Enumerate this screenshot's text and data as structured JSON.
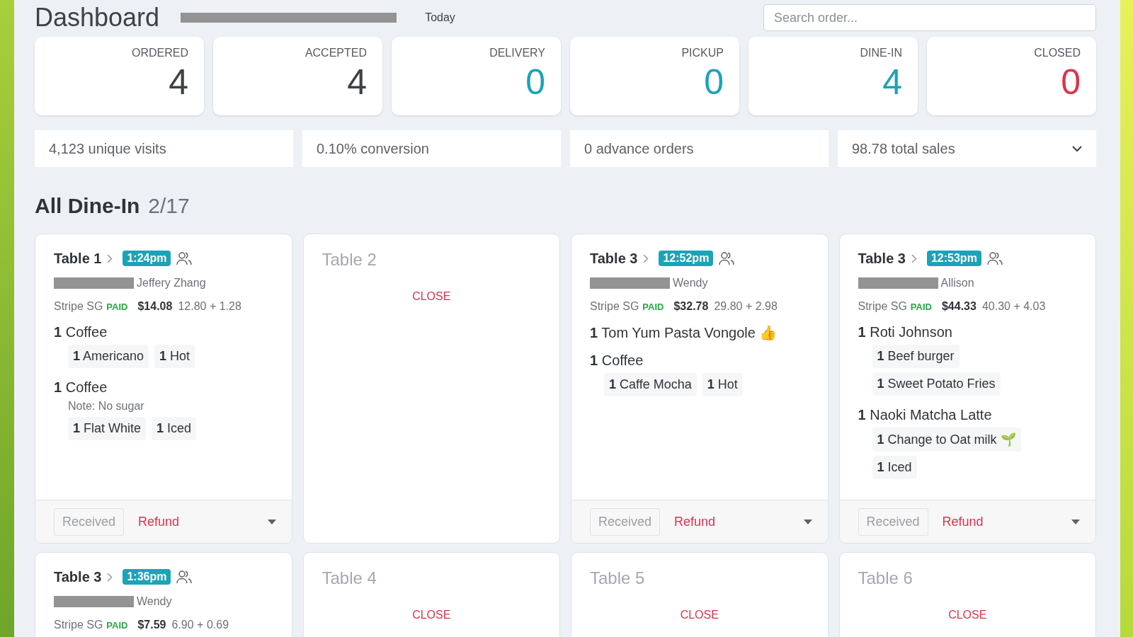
{
  "header": {
    "title": "Dashboard",
    "date": "Today",
    "search": {
      "placeholder": "Search order..."
    }
  },
  "stats": [
    {
      "label": "ORDERED",
      "value": "4",
      "color": "#3d4247"
    },
    {
      "label": "ACCEPTED",
      "value": "4",
      "color": "#3d4247"
    },
    {
      "label": "DELIVERY",
      "value": "0",
      "color": "#1ba3b9"
    },
    {
      "label": "PICKUP",
      "value": "0",
      "color": "#1ba3b9"
    },
    {
      "label": "DINE-IN",
      "value": "4",
      "color": "#1ba3b9"
    },
    {
      "label": "CLOSED",
      "value": "0",
      "color": "#e0314b"
    }
  ],
  "metrics": [
    {
      "kind": "text",
      "text": "4,123 unique visits"
    },
    {
      "kind": "text",
      "text": "0.10% conversion"
    },
    {
      "kind": "text",
      "text": "0 advance orders"
    },
    {
      "kind": "dropdown",
      "text": "98.78 total sales"
    }
  ],
  "section": {
    "title": "All Dine-In",
    "count": "2/17"
  },
  "tables": [
    {
      "kind": "order",
      "name": "Table 1",
      "time": "1:24pm",
      "customer": "Jeffery Zhang",
      "payment": "Stripe SG",
      "status": "PAID",
      "total": "$14.08",
      "breakdown": "12.80 + 1.28",
      "items": [
        {
          "qty": "1",
          "name": "Coffee",
          "option_lines": [
            [
              {
                "qty": "1",
                "name": "Americano"
              },
              {
                "qty": "1",
                "name": "Hot"
              }
            ]
          ]
        },
        {
          "qty": "1",
          "name": "Coffee",
          "note": "Note: No sugar",
          "option_lines": [
            [
              {
                "qty": "1",
                "name": "Flat White"
              },
              {
                "qty": "1",
                "name": "Iced"
              }
            ]
          ]
        }
      ],
      "received": "Received",
      "refund": "Refund"
    },
    {
      "kind": "empty",
      "name": "Table 2",
      "action": "CLOSE"
    },
    {
      "kind": "order",
      "name": "Table 3",
      "time": "12:52pm",
      "customer": "Wendy",
      "payment": "Stripe SG",
      "status": "PAID",
      "total": "$32.78",
      "breakdown": "29.80 + 2.98",
      "items": [
        {
          "qty": "1",
          "name": "Tom Yum Pasta Vongole 👍"
        },
        {
          "qty": "1",
          "name": "Coffee",
          "option_lines": [
            [
              {
                "qty": "1",
                "name": "Caffe Mocha"
              },
              {
                "qty": "1",
                "name": "Hot"
              }
            ]
          ]
        }
      ],
      "received": "Received",
      "refund": "Refund"
    },
    {
      "kind": "order",
      "name": "Table 3",
      "time": "12:53pm",
      "customer": "Allison",
      "payment": "Stripe SG",
      "status": "PAID",
      "total": "$44.33",
      "breakdown": "40.30 + 4.03",
      "items": [
        {
          "qty": "1",
          "name": "Roti Johnson",
          "option_lines": [
            [
              {
                "qty": "1",
                "name": "Beef burger"
              }
            ],
            [
              {
                "qty": "1",
                "name": "Sweet Potato Fries"
              }
            ]
          ]
        },
        {
          "qty": "1",
          "name": "Naoki Matcha Latte",
          "option_lines": [
            [
              {
                "qty": "1",
                "name": "Change to Oat milk 🌱"
              }
            ],
            [
              {
                "qty": "1",
                "name": "Iced"
              }
            ]
          ]
        }
      ],
      "received": "Received",
      "refund": "Refund"
    },
    {
      "kind": "order",
      "name": "Table 3",
      "time": "1:36pm",
      "customer": "Wendy",
      "payment": "Stripe SG",
      "status": "PAID",
      "total": "$7.59",
      "breakdown": "6.90 + 0.69"
    },
    {
      "kind": "empty",
      "name": "Table 4",
      "action": "CLOSE"
    },
    {
      "kind": "empty",
      "name": "Table 5",
      "action": "CLOSE"
    },
    {
      "kind": "empty",
      "name": "Table 6",
      "action": "CLOSE"
    }
  ]
}
